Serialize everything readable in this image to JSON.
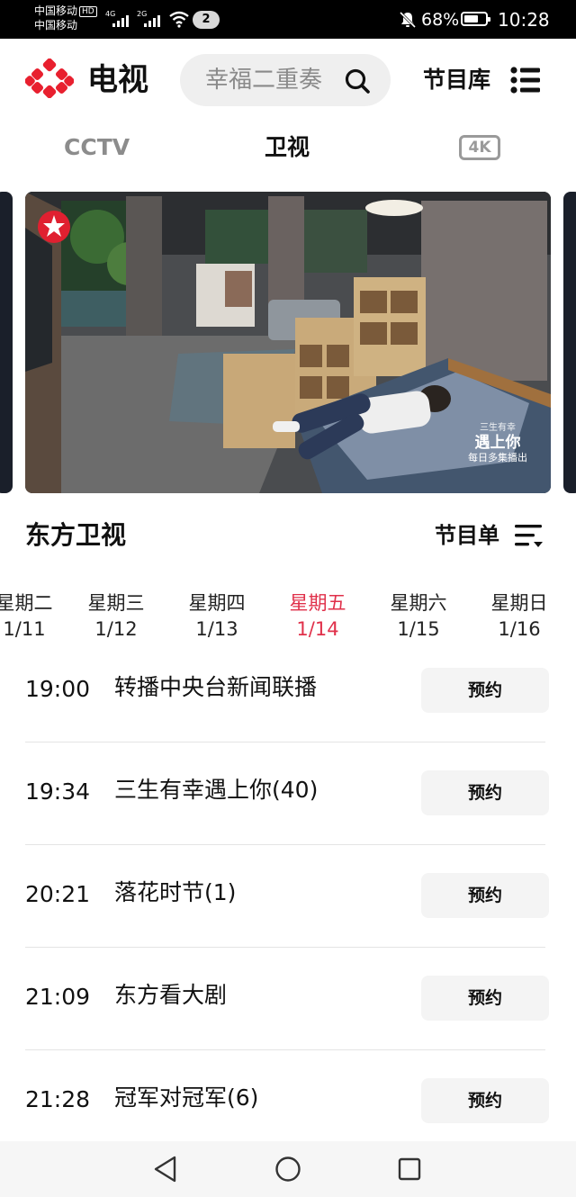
{
  "status_bar": {
    "carrier_1": "中国移动",
    "carrier_hd": "HD",
    "carrier_2": "中国移动",
    "signal_1_tag": "4G",
    "signal_2_tag": "2G",
    "notification_count": "2",
    "battery_text": "68%",
    "battery_level": 0.68,
    "time": "10:28"
  },
  "header": {
    "app_title": "电视",
    "search_placeholder": "幸福二重奏",
    "library_label": "节目库"
  },
  "top_tabs": [
    {
      "label": "CCTV",
      "active": false
    },
    {
      "label": "卫视",
      "active": true
    },
    {
      "label": "4K",
      "active": false
    }
  ],
  "video": {
    "overlay_small": "三生有幸",
    "overlay_title": "遇上你",
    "overlay_sub": "每日多集播出"
  },
  "channel": {
    "name": "东方卫视",
    "schedule_label": "节目单"
  },
  "days": [
    {
      "name": "星期二",
      "date": "1/11",
      "active": false
    },
    {
      "name": "星期三",
      "date": "1/12",
      "active": false
    },
    {
      "name": "星期四",
      "date": "1/13",
      "active": false
    },
    {
      "name": "星期五",
      "date": "1/14",
      "active": true
    },
    {
      "name": "星期六",
      "date": "1/15",
      "active": false
    },
    {
      "name": "星期日",
      "date": "1/16",
      "active": false
    }
  ],
  "programs": [
    {
      "time": "19:00",
      "title": "转播中央台新闻联播",
      "button": "预约"
    },
    {
      "time": "19:34",
      "title": "三生有幸遇上你(40)",
      "button": "预约"
    },
    {
      "time": "20:21",
      "title": "落花时节(1)",
      "button": "预约"
    },
    {
      "time": "21:09",
      "title": "东方看大剧",
      "button": "预约"
    },
    {
      "time": "21:28",
      "title": "冠军对冠军(6)",
      "button": "预约"
    }
  ],
  "colors": {
    "accent": "#e0304a",
    "brand_red": "#e8202f",
    "text": "#111111",
    "muted": "#8c8c8c"
  }
}
